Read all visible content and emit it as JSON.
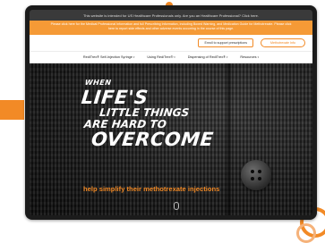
{
  "topbar": {
    "text": "This website is intended for US Healthcare Professionals only. Are you an Healthcare Professional? Click here."
  },
  "notice": {
    "text": "Please click here for the Medical Professional Information and full Prescribing Information, including Boxed Warning, and Medication Guide for Methotrexate. Please click here to report side effects and other adverse events occurring in the course of this page."
  },
  "utility": {
    "button_label": "Enroll to support prescriptions",
    "pill_label": "Methotrexate Info"
  },
  "nav": {
    "items": [
      {
        "label": "RediTrex® Self-Injection Syringe"
      },
      {
        "label": "Using RediTrex®"
      },
      {
        "label": "Dispensing of RediTrex®"
      },
      {
        "label": "Resources"
      }
    ]
  },
  "hero": {
    "line1": "WHEN",
    "line2": "LIFE'S",
    "line3": "LITTLE THINGS",
    "line4": "ARE HARD TO",
    "line5": "OVERCOME",
    "subline": "help simplify their methotrexate injections"
  },
  "colors": {
    "accent": "#f28a26",
    "topbar": "#3a3a3a",
    "notice": "#f59a36"
  }
}
